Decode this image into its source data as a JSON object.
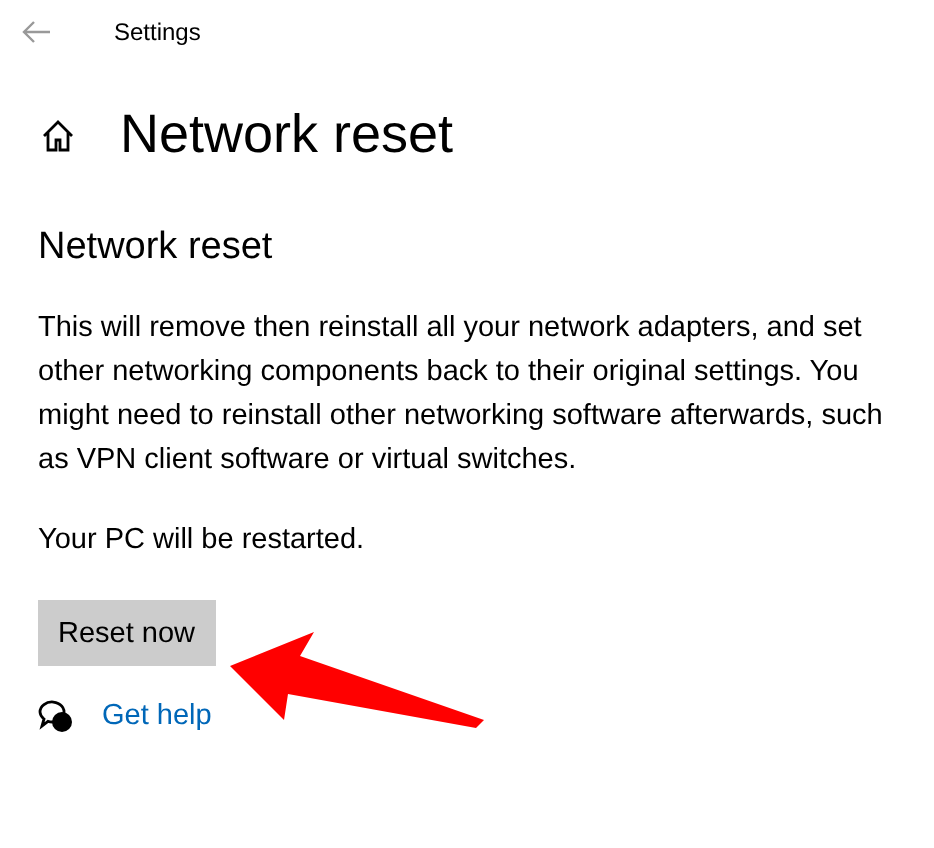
{
  "window": {
    "title": "Settings"
  },
  "page": {
    "title": "Network reset"
  },
  "section": {
    "title": "Network reset",
    "description": "This will remove then reinstall all your network adapters, and set other networking components back to their original settings. You might need to reinstall other networking software afterwards, such as VPN client software or virtual switches.",
    "note": "Your PC will be restarted."
  },
  "buttons": [
    "Reset now"
  ],
  "help_link": "Get help"
}
